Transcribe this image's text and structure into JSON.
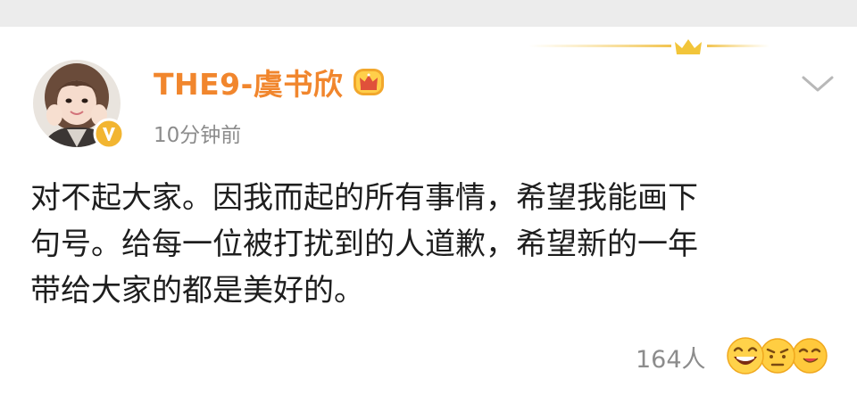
{
  "post": {
    "username": "THE9-虞书欣",
    "timestamp": "10分钟前",
    "body_lines": [
      "对不起大家。因我而起的所有事情，希望我能画下",
      "句号。给每一位被打扰到的人道歉，希望新的一年",
      "带给大家的都是美好的。"
    ],
    "reaction_count": "164人"
  },
  "icons": {
    "crown_decoration": "crown-icon",
    "verified_badge": "verified-v-icon",
    "vip_badge": "crown-badge-icon",
    "menu": "chevron-down-icon",
    "reactions": [
      "laugh-emoji-icon",
      "angry-emoji-icon",
      "love-emoji-icon"
    ]
  },
  "colors": {
    "username": "#f1862d",
    "meta": "#8c8c8c",
    "text": "#1e1e1e",
    "badge_gold": "#f2b531",
    "strip": "#ececec"
  }
}
